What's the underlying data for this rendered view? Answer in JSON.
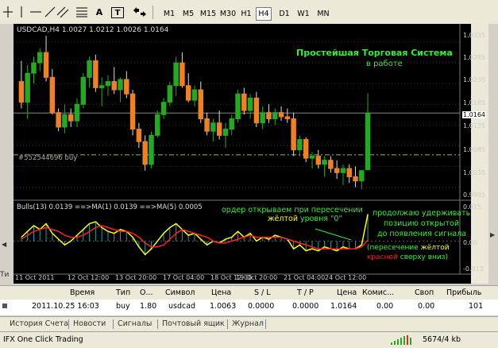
{
  "toolbar": {
    "timeframes": [
      {
        "label": "M1",
        "active": false
      },
      {
        "label": "M5",
        "active": false
      },
      {
        "label": "M15",
        "active": false
      },
      {
        "label": "M30",
        "active": false
      },
      {
        "label": "H1",
        "active": false
      },
      {
        "label": "H4",
        "active": true
      },
      {
        "label": "D1",
        "active": false
      },
      {
        "label": "W1",
        "active": false
      },
      {
        "label": "MN",
        "active": false
      }
    ],
    "text_tool": "A",
    "label_tool": "T"
  },
  "chart": {
    "info": "USDCAD,H4  1.0027 1.0212 1.0026 1.0164",
    "title_line1": "Простейшая Торговая Система",
    "title_line2": "в работе",
    "order_label": "#552544696 buy",
    "current_price": "1.0164",
    "price_ticks": [
      "1.0335",
      "1.0285",
      "1.0235",
      "1.0185",
      "1.0135",
      "1.0085",
      "1.0035",
      "0.9985"
    ],
    "indicator_info": "Bulls(13) 0.0139  ==>MA(1) 0.0139  ==>MA(5) 0.0005",
    "indicator_ticks": [
      "0.015",
      "0.00",
      "-0.013"
    ],
    "annotation_left_1": "ордер открываем при пересечении",
    "annotation_left_2a": "жёлтой",
    "annotation_left_2b": " уровня \"0\"",
    "annotation_right_1": "продолжаю удерживать",
    "annotation_right_2": "позицию открытой",
    "annotation_right_3": "до появления сигнала",
    "annotation_right_4a": "(пересечение ",
    "annotation_right_4b": "жёлтой",
    "annotation_right_5a": "красной",
    "annotation_right_5b": " сверху вниз)",
    "time_labels": [
      "11 Oct 2011",
      "12 Oct 12:00",
      "13 Oct 20:00",
      "17 Oct 04:00",
      "18 Oct 12:00",
      "19 Oct 20:00",
      "21 Oct 04:00",
      "24 Oct 12:00"
    ],
    "colors": {
      "bull": "#22aa22",
      "bear": "#f08020",
      "grid": "#555555",
      "yellow": "#ffff00",
      "red": "#ff2020",
      "teal": "#20a0a0",
      "green_text": "#33ee33"
    }
  },
  "chart_data": {
    "type": "candlestick",
    "symbol": "USDCAD",
    "timeframe": "H4",
    "ylim": [
      0.9965,
      1.036
    ],
    "candles": [
      [
        1.024,
        1.029,
        1.0175,
        1.019
      ],
      [
        1.019,
        1.028,
        1.015,
        1.026
      ],
      [
        1.026,
        1.03,
        1.0235,
        1.0285
      ],
      [
        1.0285,
        1.032,
        1.0265,
        1.031
      ],
      [
        1.031,
        1.035,
        1.024,
        1.025
      ],
      [
        1.025,
        1.027,
        1.016,
        1.0165
      ],
      [
        1.0165,
        1.0175,
        1.012,
        1.013
      ],
      [
        1.013,
        1.0185,
        1.0115,
        1.016
      ],
      [
        1.016,
        1.0175,
        1.013,
        1.0145
      ],
      [
        1.0145,
        1.02,
        1.013,
        1.0185
      ],
      [
        1.0185,
        1.026,
        1.0175,
        1.025
      ],
      [
        1.025,
        1.03,
        1.0225,
        1.029
      ],
      [
        1.029,
        1.0305,
        1.0215,
        1.0225
      ],
      [
        1.0225,
        1.025,
        1.018,
        1.023
      ],
      [
        1.023,
        1.0255,
        1.0205,
        1.024
      ],
      [
        1.024,
        1.0275,
        1.021,
        1.022
      ],
      [
        1.022,
        1.025,
        1.019,
        1.0245
      ],
      [
        1.0245,
        1.0265,
        1.02,
        1.021
      ],
      [
        1.021,
        1.022,
        1.011,
        1.0125
      ],
      [
        1.0125,
        1.014,
        1.008,
        1.0095
      ],
      [
        1.0095,
        1.011,
        1.0025,
        1.004
      ],
      [
        1.004,
        1.012,
        1.003,
        1.011
      ],
      [
        1.011,
        1.017,
        1.0105,
        1.016
      ],
      [
        1.016,
        1.02,
        1.015,
        1.019
      ],
      [
        1.019,
        1.024,
        1.018,
        1.023
      ],
      [
        1.023,
        1.03,
        1.0205,
        1.0285
      ],
      [
        1.0285,
        1.031,
        1.0225,
        1.023
      ],
      [
        1.023,
        1.026,
        1.019,
        1.0195
      ],
      [
        1.0195,
        1.023,
        1.018,
        1.022
      ],
      [
        1.022,
        1.024,
        1.014,
        1.015
      ],
      [
        1.015,
        1.0165,
        1.011,
        1.012
      ],
      [
        1.012,
        1.015,
        1.0095,
        1.014
      ],
      [
        1.014,
        1.017,
        1.01,
        1.011
      ],
      [
        1.011,
        1.014,
        1.008,
        1.0125
      ],
      [
        1.0125,
        1.016,
        1.011,
        1.015
      ],
      [
        1.015,
        1.022,
        1.014,
        1.021
      ],
      [
        1.021,
        1.0225,
        1.016,
        1.017
      ],
      [
        1.017,
        1.021,
        1.015,
        1.02
      ],
      [
        1.02,
        1.0215,
        1.013,
        1.014
      ],
      [
        1.014,
        1.018,
        1.0125,
        1.0165
      ],
      [
        1.0165,
        1.0185,
        1.014,
        1.015
      ],
      [
        1.015,
        1.0175,
        1.0135,
        1.0165
      ],
      [
        1.0165,
        1.018,
        1.0145,
        1.0155
      ],
      [
        1.0155,
        1.0175,
        1.014,
        1.015
      ],
      [
        1.015,
        1.0165,
        1.006,
        1.0075
      ],
      [
        1.0075,
        1.011,
        1.006,
        1.01
      ],
      [
        1.01,
        1.0105,
        1.0045,
        1.0055
      ],
      [
        1.0055,
        1.007,
        1.003,
        1.006
      ],
      [
        1.006,
        1.0075,
        1.003,
        1.004
      ],
      [
        1.004,
        1.006,
        1.001,
        1.005
      ],
      [
        1.005,
        1.006,
        1.002,
        1.003
      ],
      [
        1.003,
        1.005,
        1.0005,
        1.002
      ],
      [
        1.002,
        1.004,
        0.999,
        1.003
      ],
      [
        1.003,
        1.004,
        0.9995,
        1.001
      ],
      [
        1.001,
        1.0035,
        0.9985,
        1.0
      ],
      [
        1.0,
        1.0025,
        0.998,
        1.0025
      ],
      [
        1.0027,
        1.0212,
        1.0026,
        1.0164
      ]
    ],
    "current_price": 1.0164,
    "order_price": 1.0063,
    "indicator_ylim": [
      -0.015,
      0.017
    ],
    "bulls": [
      0.002,
      0.005,
      0.008,
      0.006,
      0.009,
      0.004,
      0.001,
      -0.002,
      0.0,
      0.003,
      0.006,
      0.009,
      0.01,
      0.007,
      0.005,
      0.004,
      0.006,
      0.005,
      0.002,
      -0.003,
      -0.007,
      -0.004,
      0.0,
      0.004,
      0.007,
      0.009,
      0.006,
      0.003,
      0.004,
      0.001,
      -0.002,
      0.0,
      -0.001,
      0.001,
      0.002,
      0.005,
      0.002,
      0.004,
      0.0,
      0.002,
      0.001,
      0.003,
      0.002,
      0.001,
      -0.004,
      -0.002,
      -0.005,
      -0.004,
      -0.005,
      -0.003,
      -0.004,
      -0.005,
      -0.003,
      -0.004,
      -0.004,
      -0.002,
      0.0139
    ],
    "ma5": [
      0.001,
      0.003,
      0.005,
      0.006,
      0.007,
      0.006,
      0.005,
      0.003,
      0.002,
      0.002,
      0.003,
      0.005,
      0.007,
      0.008,
      0.007,
      0.006,
      0.005,
      0.005,
      0.004,
      0.002,
      -0.001,
      -0.003,
      -0.003,
      -0.002,
      0.001,
      0.004,
      0.006,
      0.005,
      0.004,
      0.003,
      0.002,
      0.0,
      -0.001,
      -0.001,
      0.0,
      0.001,
      0.002,
      0.003,
      0.002,
      0.002,
      0.002,
      0.002,
      0.002,
      0.001,
      0.0,
      -0.001,
      -0.002,
      -0.003,
      -0.004,
      -0.004,
      -0.004,
      -0.004,
      -0.004,
      -0.004,
      -0.004,
      -0.003,
      0.0005
    ],
    "time_labels": [
      "11 Oct 2011",
      "12 Oct 12:00",
      "13 Oct 20:00",
      "17 Oct 04:00",
      "18 Oct 12:00",
      "19 Oct 20:00",
      "21 Oct 04:00",
      "24 Oct 12:00"
    ]
  },
  "table": {
    "headers": [
      "Время",
      "Тип",
      "О...",
      "Символ",
      "Цена",
      "S / L",
      "T / P",
      "Цена",
      "Комис...",
      "Своп",
      "Прибыль"
    ],
    "row": [
      "2011.10.25 16:03",
      "buy",
      "1.80",
      "usdcad",
      "1.0063",
      "0.0000",
      "0.0000",
      "1.0164",
      "0.00",
      "0.00",
      "101"
    ]
  },
  "tabs": [
    "История Счета",
    "Новости",
    "Сигналы",
    "Почтовый ящик",
    "Журнал"
  ],
  "status": {
    "left": "IFX One Click Trading",
    "right": "5674/4 kb"
  }
}
